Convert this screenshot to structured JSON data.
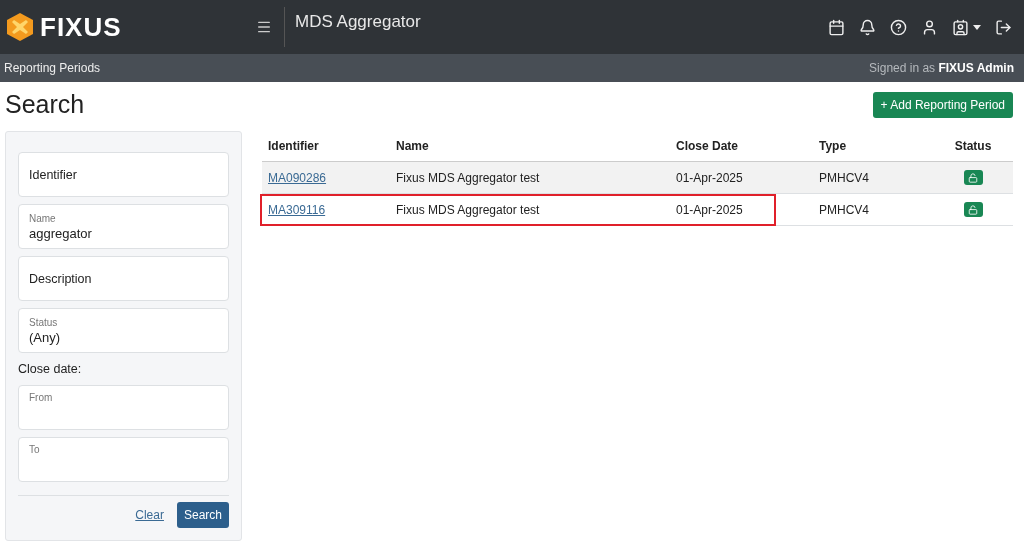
{
  "header": {
    "brand": "FIXUS",
    "app_title": "MDS Aggregator"
  },
  "subbar": {
    "section": "Reporting Periods",
    "signed_in": "Signed in as **FIXUS Admin**"
  },
  "page_title": "Search",
  "add_button": "+ Add Reporting Period",
  "filters": [
    {
      "kind": "plain",
      "placeholder": "Identifier"
    },
    {
      "kind": "floating",
      "label": "Name",
      "value": "aggregator"
    },
    {
      "kind": "plain",
      "placeholder": "Description"
    },
    {
      "kind": "floating",
      "label": "Status",
      "value": "(Any)"
    }
  ],
  "close_date": {
    "label": "Close date:",
    "fields": [
      {
        "label": "From"
      },
      {
        "label": "To"
      }
    ]
  },
  "filter_actions": {
    "clear": "Clear",
    "search": "Search"
  },
  "table": {
    "columns": [
      "Identifier",
      "Name",
      "Close Date",
      "Type",
      "Status"
    ],
    "rows": [
      {
        "identifier": "MA090286",
        "name": "Fixus MDS Aggregator test",
        "close_date": "01-Apr-2025",
        "type": "PMHCV4",
        "locked": false,
        "shaded": true,
        "highlighted": false
      },
      {
        "identifier": "MA309116",
        "name": "Fixus MDS Aggregator test",
        "close_date": "01-Apr-2025",
        "type": "PMHCV4",
        "locked": false,
        "shaded": false,
        "highlighted": true
      }
    ]
  }
}
